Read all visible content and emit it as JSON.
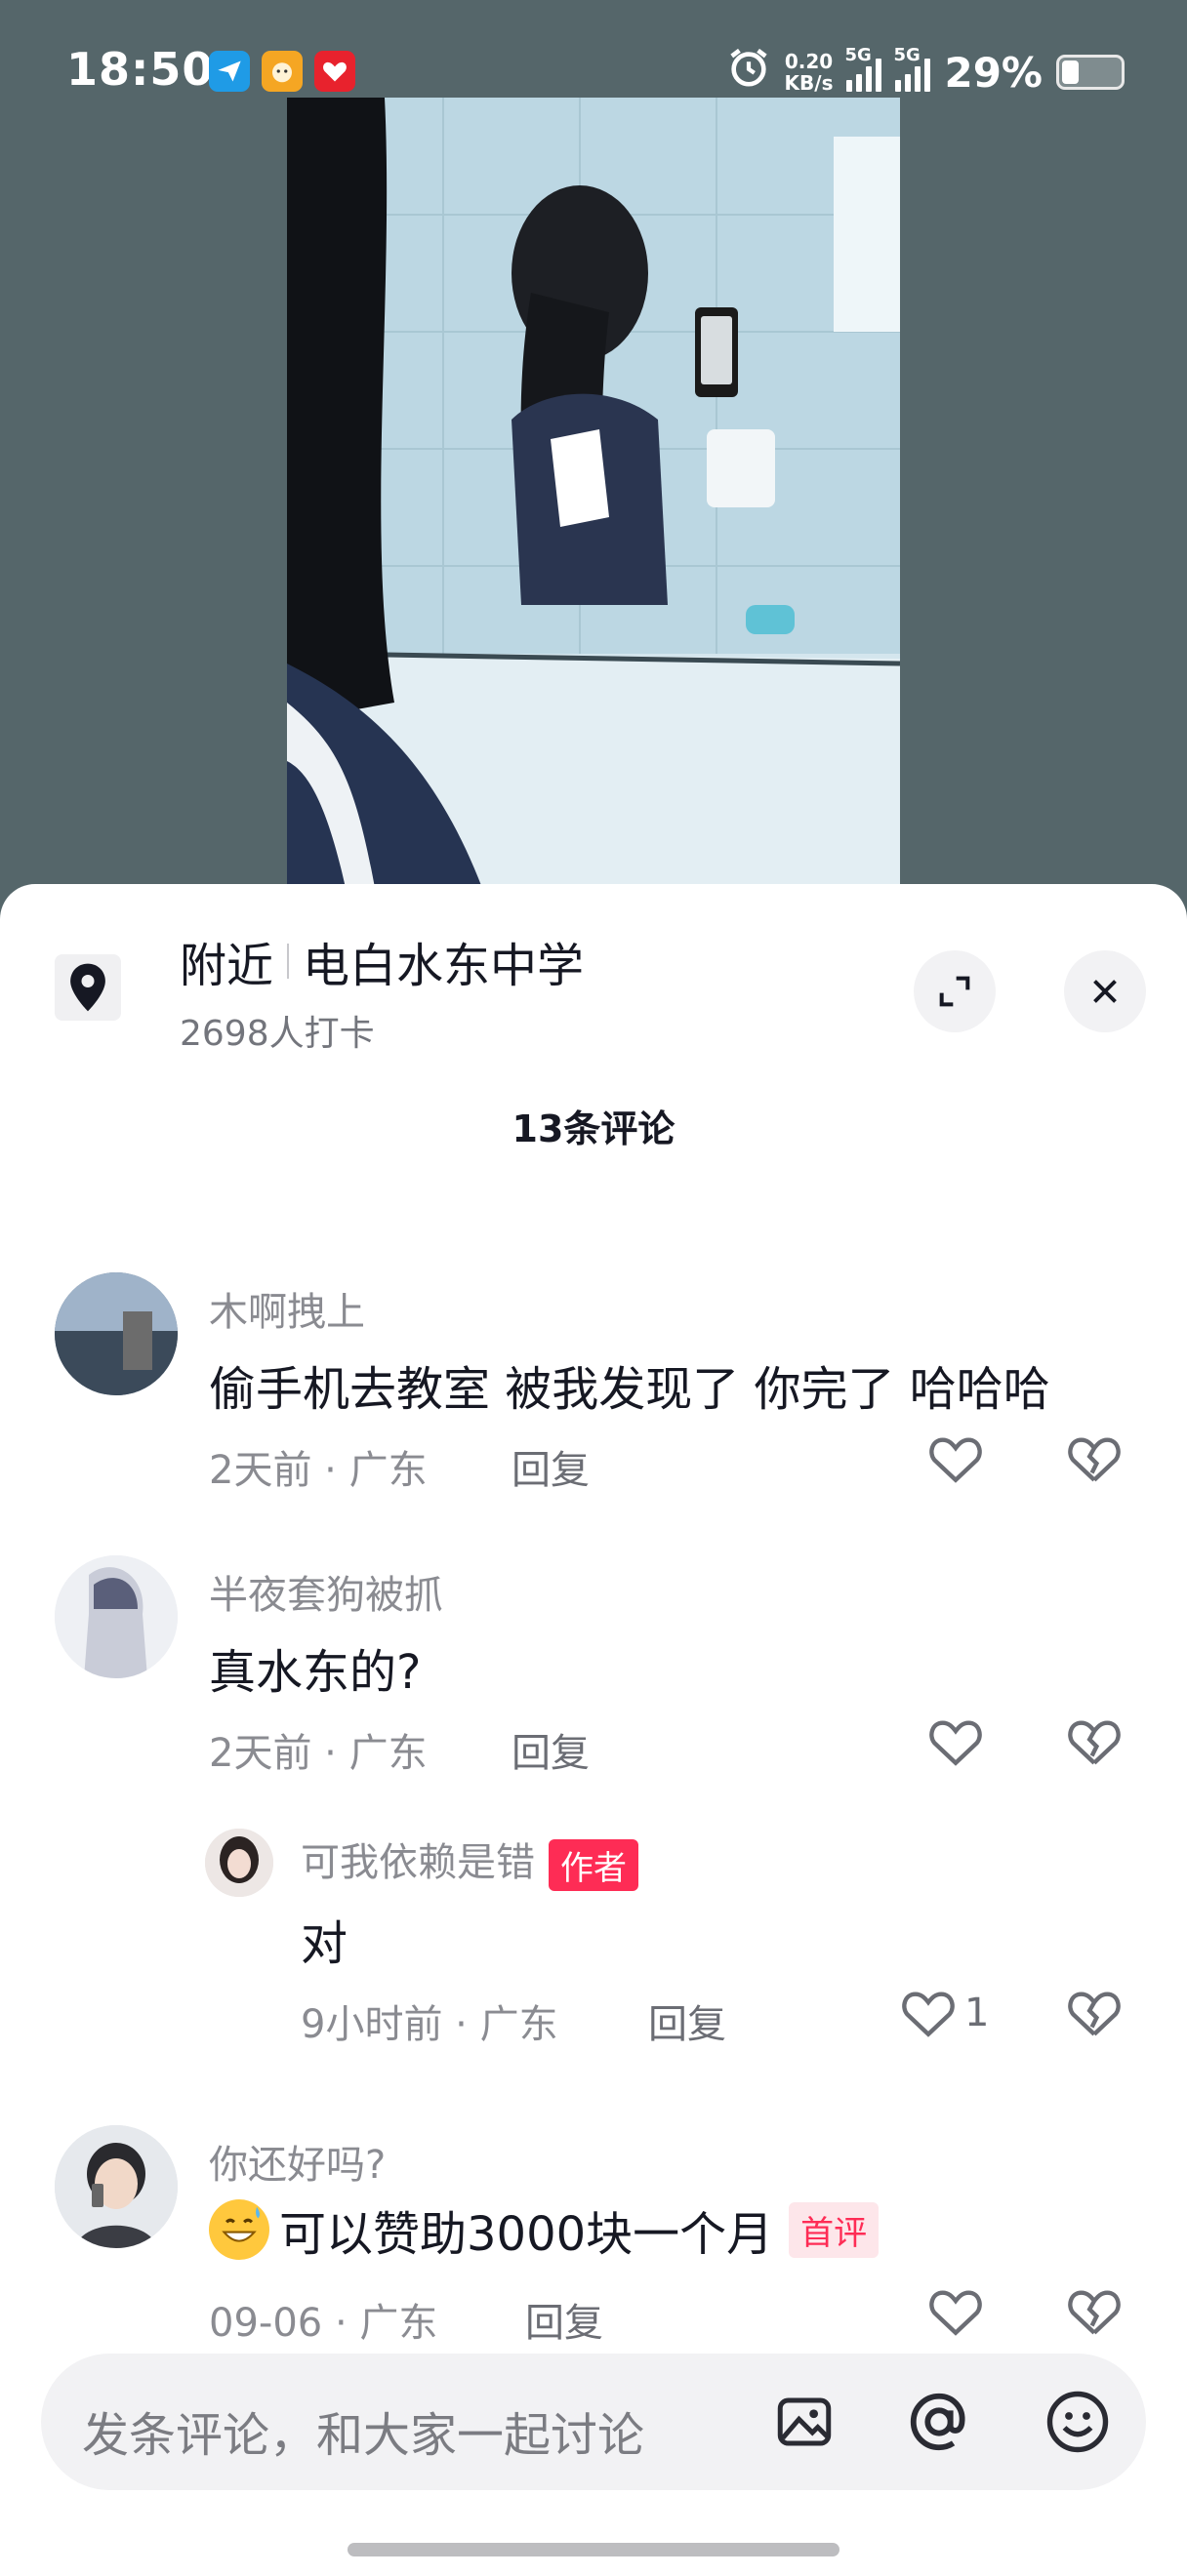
{
  "status_bar": {
    "time": "18:50",
    "speed_top": "0.20",
    "speed_bottom": "KB/s",
    "signal1_label": "5G",
    "signal2_label": "5G",
    "battery": "29%",
    "battery_level": 0.29
  },
  "location": {
    "prefix": "附近",
    "name": "电白水东中学",
    "checkins": "2698人打卡"
  },
  "comments_header": "13条评论",
  "comments": [
    {
      "user": "木啊拽上",
      "text": "偷手机去教室 被我发现了 你完了 哈哈哈",
      "time_loc": "2天前 · 广东",
      "reply": "回复"
    },
    {
      "user": "半夜套狗被抓",
      "text": "真水东的?",
      "time_loc": "2天前 · 广东",
      "reply": "回复"
    },
    {
      "user": "可我依赖是错",
      "tag": "作者",
      "text": "对",
      "time_loc": "9小时前 · 广东",
      "reply": "回复",
      "likes": "1"
    },
    {
      "user": "你还好吗?",
      "text": "可以赞助3000块一个月",
      "tag": "首评",
      "time_loc": "09-06 · 广东",
      "reply": "回复"
    }
  ],
  "input": {
    "placeholder": "发条评论，和大家一起讨论"
  }
}
